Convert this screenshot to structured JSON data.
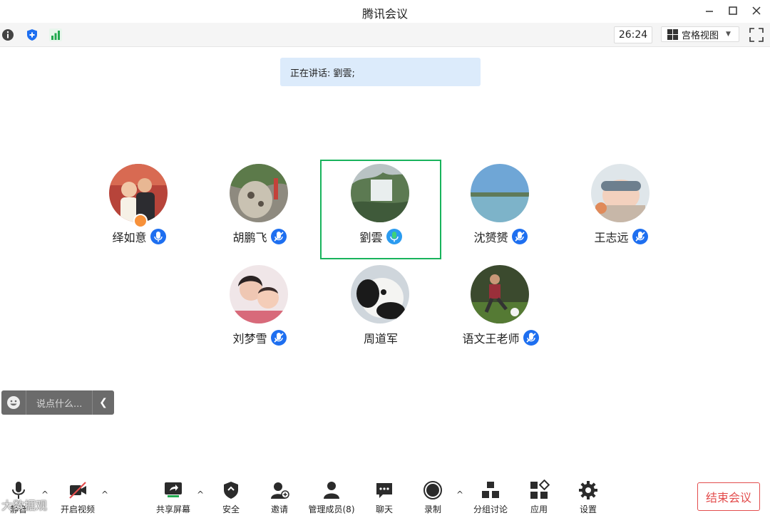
{
  "window": {
    "title": "腾讯会议"
  },
  "infobar": {
    "timer": "26:24",
    "view_label": "宫格视图"
  },
  "speaking": {
    "text": "正在讲话: 劉雲;"
  },
  "participants": [
    {
      "name": "绎如意",
      "mic": "on",
      "host": true
    },
    {
      "name": "胡鹏飞",
      "mic": "muted"
    },
    {
      "name": "劉雲",
      "mic": "speaking",
      "active": true
    },
    {
      "name": "沈赟赟",
      "mic": "muted"
    },
    {
      "name": "王志远",
      "mic": "muted"
    },
    {
      "name": "刘梦雪",
      "mic": "muted"
    },
    {
      "name": "周道军",
      "mic": "none"
    },
    {
      "name": "语文王老师",
      "mic": "muted"
    }
  ],
  "chat": {
    "placeholder": "说点什么..."
  },
  "toolbar": {
    "mute": "静音",
    "video": "开启视频",
    "share": "共享屏幕",
    "security": "安全",
    "invite": "邀请",
    "members": "管理成员(8)",
    "chat": "聊天",
    "record": "录制",
    "breakout": "分组讨论",
    "apps": "应用",
    "settings": "设置",
    "end": "结束会议"
  },
  "watermark": "大数据观",
  "colors": {
    "active_border": "#18b35c",
    "speaking_bg": "#dcebfb",
    "mic_blue": "#1e6ff0",
    "end_red": "#e34d4d"
  }
}
